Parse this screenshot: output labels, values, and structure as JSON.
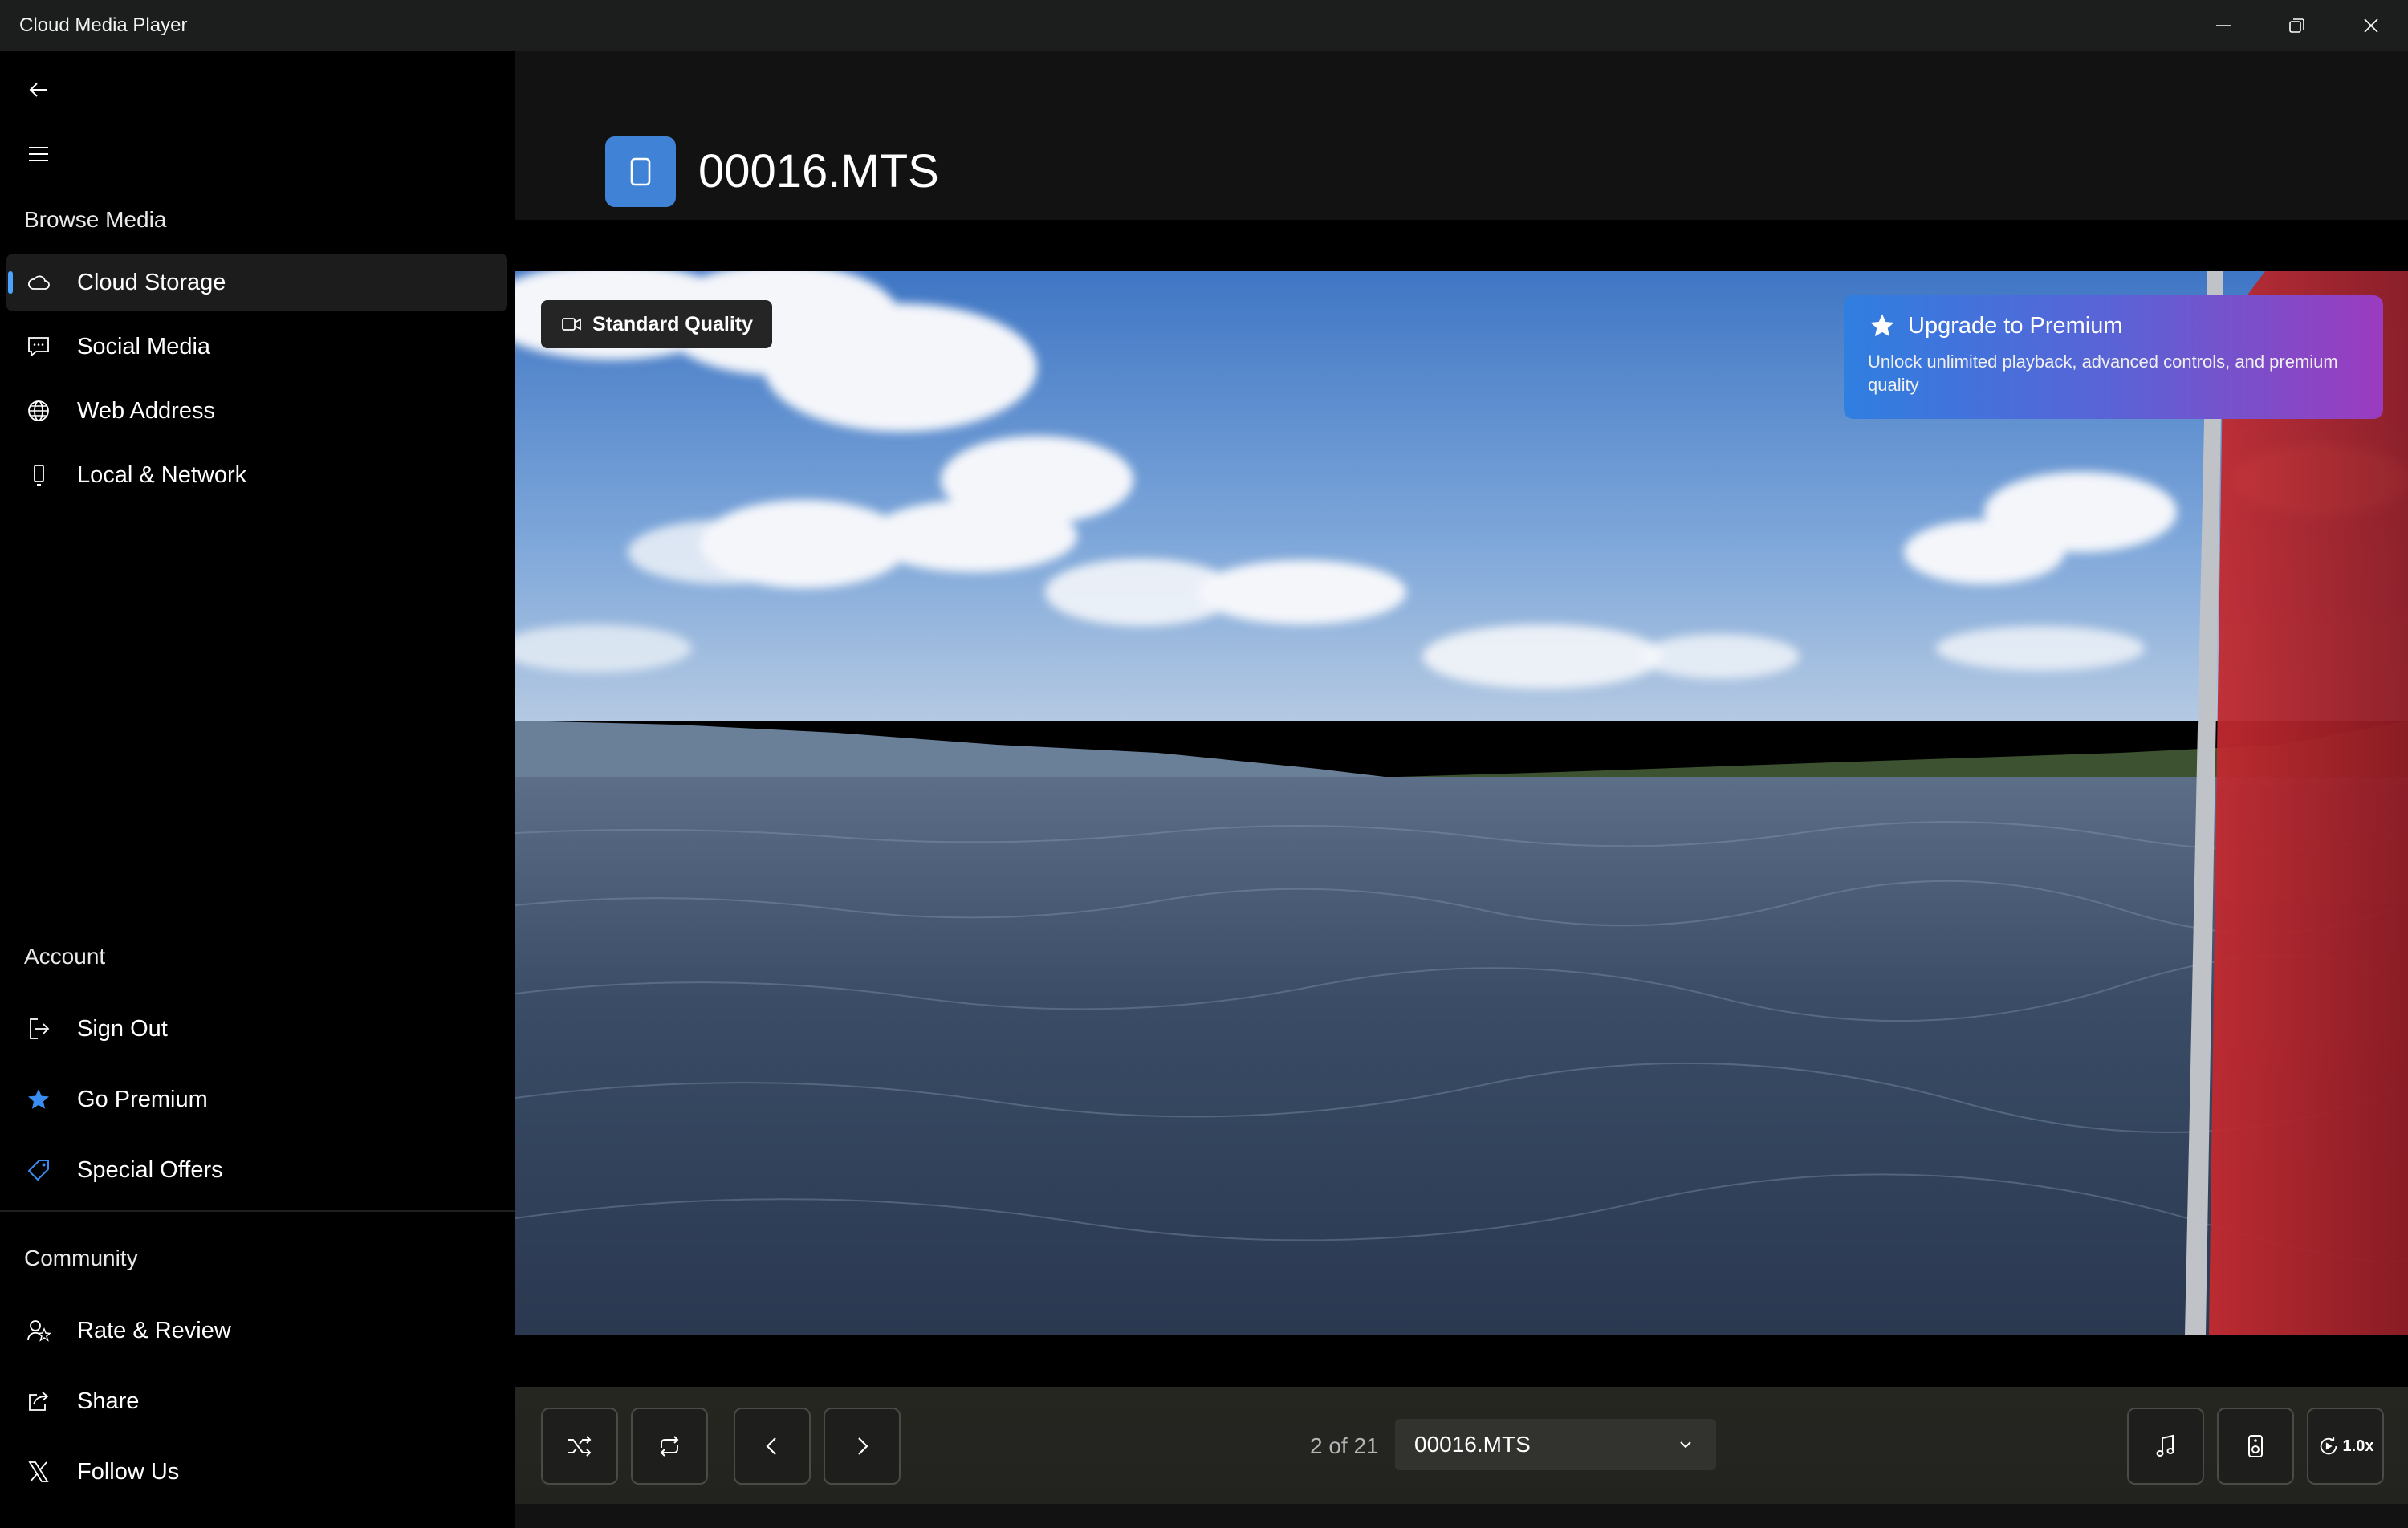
{
  "window": {
    "title": "Cloud Media Player",
    "controls": [
      "minimize-icon",
      "restore-icon",
      "close-icon"
    ]
  },
  "sidebar": {
    "browse_heading": "Browse Media",
    "browse_items": [
      {
        "label": "Cloud Storage",
        "icon": "cloud-icon",
        "active": true
      },
      {
        "label": "Social Media",
        "icon": "chat-icon"
      },
      {
        "label": "Web Address",
        "icon": "globe-icon"
      },
      {
        "label": "Local & Network",
        "icon": "phone-icon"
      }
    ],
    "account_heading": "Account",
    "account_items": [
      {
        "label": "Sign Out",
        "icon": "sign-out-icon"
      },
      {
        "label": "Go Premium",
        "icon": "star-icon"
      },
      {
        "label": "Special Offers",
        "icon": "tag-icon"
      }
    ],
    "community_heading": "Community",
    "community_items": [
      {
        "label": "Rate & Review",
        "icon": "rate-review-icon"
      },
      {
        "label": "Share",
        "icon": "share-icon"
      },
      {
        "label": "Follow Us",
        "icon": "x-logo-icon"
      }
    ]
  },
  "header": {
    "file_title": "00016.MTS",
    "file_icon": "file-icon"
  },
  "player": {
    "quality_label": "Standard Quality",
    "premium": {
      "title": "Upgrade to Premium",
      "description": "Unlock unlimited playback, advanced controls, and premium quality"
    }
  },
  "controls": {
    "position_text": "2 of 21",
    "current_file": "00016.MTS",
    "speed": "1.0x",
    "buttons": [
      "shuffle-icon",
      "repeat-icon",
      "previous-icon",
      "next-icon",
      "music-note-icon",
      "speaker-icon",
      "playback-speed-icon"
    ]
  },
  "colors": {
    "accent": "#4aa3ff",
    "file_icon_bg": "#3f82d6",
    "premium_gradient_start": "#2f7fe0",
    "premium_gradient_end": "#9b3bbf",
    "sidebar_bg": "#000000",
    "main_bg": "#121212"
  }
}
